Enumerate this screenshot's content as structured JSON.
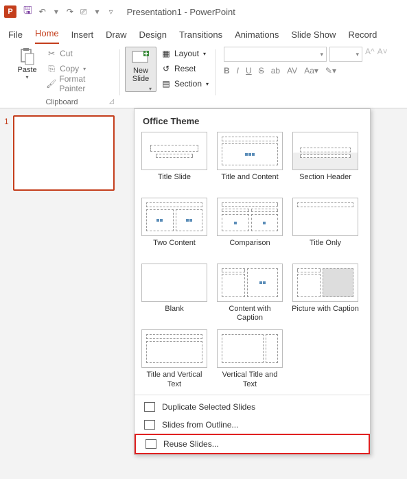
{
  "titlebar": {
    "app_letter": "P",
    "document_title": "Presentation1  -  PowerPoint"
  },
  "tabs": {
    "file": "File",
    "home": "Home",
    "insert": "Insert",
    "draw": "Draw",
    "design": "Design",
    "transitions": "Transitions",
    "animations": "Animations",
    "slideshow": "Slide Show",
    "record": "Record"
  },
  "ribbon": {
    "paste": "Paste",
    "cut": "Cut",
    "copy": "Copy",
    "format_painter": "Format Painter",
    "clipboard_group": "Clipboard",
    "new_slide": "New\nSlide",
    "layout": "Layout",
    "reset": "Reset",
    "section": "Section",
    "font_b": "B",
    "font_i": "I",
    "font_u": "U",
    "font_s": "S"
  },
  "thumbnails": {
    "slide1_num": "1"
  },
  "dropdown": {
    "header": "Office Theme",
    "layouts": [
      "Title Slide",
      "Title and Content",
      "Section Header",
      "Two Content",
      "Comparison",
      "Title Only",
      "Blank",
      "Content with Caption",
      "Picture with Caption",
      "Title and Vertical Text",
      "Vertical Title and Text"
    ],
    "duplicate": "Duplicate Selected Slides",
    "outline": "Slides from Outline...",
    "reuse": "Reuse Slides..."
  }
}
